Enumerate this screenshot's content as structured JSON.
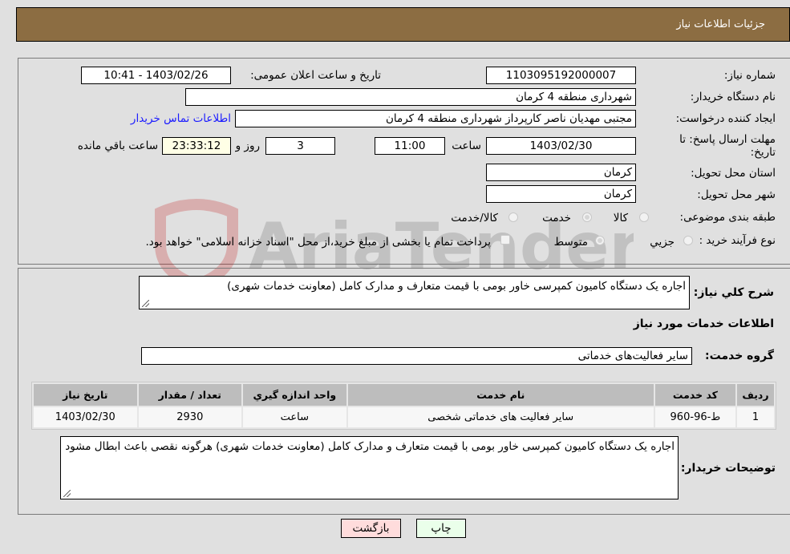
{
  "header": {
    "title": "جزئیات اطلاعات نیاز"
  },
  "form": {
    "need_number": {
      "label": "شماره نیاز:",
      "value": "1103095192000007"
    },
    "announce_datetime": {
      "label": "تاریخ و ساعت اعلان عمومی:",
      "value": "1403/02/26 - 10:41"
    },
    "buyer_org": {
      "label": "نام دستگاه خریدار:",
      "value": "شهرداری منطقه 4 کرمان"
    },
    "requester": {
      "label": "ایجاد کننده درخواست:",
      "value": "مجتبی مهدیان ناصر کارپرداز شهرداری منطقه 4 کرمان"
    },
    "buyer_contact_link": "اطلاعات تماس خریدار",
    "deadline": {
      "label_line1": "مهلت ارسال پاسخ: تا",
      "label_line2": "تاریخ:",
      "date": "1403/02/30",
      "time_label": "ساعت",
      "time": "11:00",
      "days": "3",
      "days_label": "روز و",
      "remaining": "23:33:12",
      "remaining_label": "ساعت باقي مانده"
    },
    "province": {
      "label": "استان محل تحویل:",
      "value": "کرمان"
    },
    "city": {
      "label": "شهر محل تحویل:",
      "value": "کرمان"
    },
    "category": {
      "label": "طبقه بندی موضوعی:",
      "options": [
        "کالا",
        "خدمت",
        "کالا/خدمت"
      ],
      "selected": "خدمت"
    },
    "purchase_type": {
      "label": "نوع فرآیند خرید :",
      "options": [
        "جزيي",
        "متوسط"
      ],
      "selected": "متوسط",
      "treasury_checkbox_label": "پرداخت تمام یا بخشی از مبلغ خرید،از محل \"اسناد خزانه اسلامی\" خواهد بود.",
      "treasury_checked": false
    }
  },
  "details": {
    "description_label": "شرح کلي نياز:",
    "description": "اجاره یک دستگاه کامیون کمپرسی خاور بومی با قیمت متعارف و مدارک کامل (معاونت خدمات شهری)",
    "services_heading": "اطلاعات خدمات مورد نياز",
    "service_group_label": "گروه خدمت:",
    "service_group": "سایر فعالیت‌های خدماتی",
    "table": {
      "headers": [
        "رديف",
        "كد خدمت",
        "نام خدمت",
        "واحد اندازه گيري",
        "تعداد / مقدار",
        "تاريخ نياز"
      ],
      "rows": [
        [
          "1",
          "ط-96-960",
          "سایر فعالیت های خدماتی شخصی",
          "ساعت",
          "2930",
          "1403/02/30"
        ]
      ]
    },
    "buyer_notes_label": "توضيحات خريدار:",
    "buyer_notes": "اجاره یک دستگاه کامیون کمپرسی خاور بومی با قیمت متعارف و مدارک کامل (معاونت خدمات شهری) هرگونه نقصی باعث ابطال مشود"
  },
  "buttons": {
    "print": "چاپ",
    "back": "بازگشت"
  },
  "colors": {
    "header_bg": "#8c6d42",
    "print_bg": "#eaffea",
    "back_bg": "#ffdcdc",
    "link": "#1a1aff"
  },
  "watermark": {
    "text": "AriaTender.neT"
  }
}
